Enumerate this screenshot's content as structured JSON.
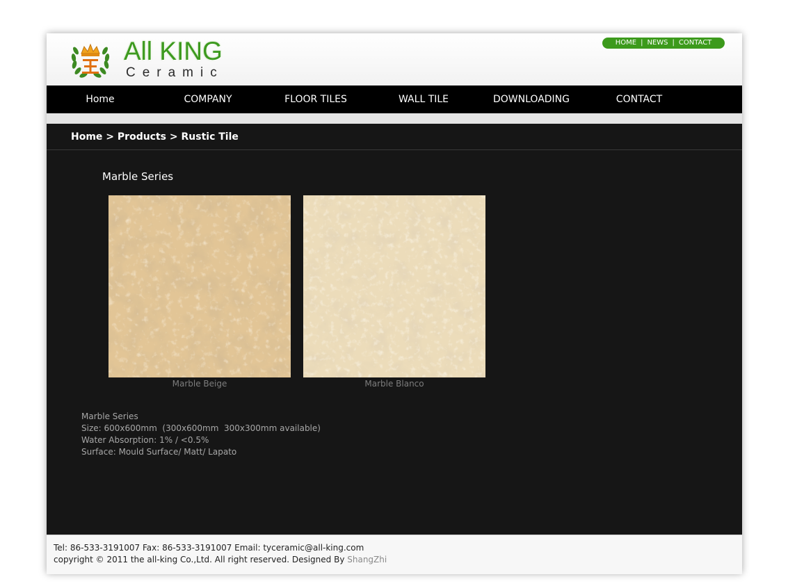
{
  "header": {
    "logo_text": "All KING",
    "logo_subtext": "Ceramic",
    "top_links": [
      "HOME",
      "NEWS",
      "CONTACT"
    ]
  },
  "nav": {
    "items": [
      "Home",
      "COMPANY",
      "FLOOR TILES",
      "WALL TILE",
      "DOWNLOADING",
      "CONTACT"
    ]
  },
  "breadcrumb": {
    "home": "Home",
    "products": "Products",
    "current": "Rustic Tile",
    "separator": ">"
  },
  "main": {
    "series_title": "Marble Series",
    "products": [
      {
        "name": "Marble Beige",
        "color": "#e2c596"
      },
      {
        "name": "Marble Blanco",
        "color": "#ecdcba"
      }
    ],
    "specs": [
      "Marble Series",
      "Size: 600x600mm  (300x600mm  300x300mm available)",
      "Water Absorption: 1% / <0.5%",
      "Surface: Mould Surface/ Matt/ Lapato"
    ]
  },
  "footer": {
    "contact_line": "Tel: 86-533-3191007 Fax: 86-533-3191007 Email: tyceramic@all-king.com",
    "copyright_text": "copyright © 2011 the all-king Co.,Ltd. All right reserved. Designed By ",
    "designer": "ShangZhi"
  },
  "colors": {
    "brand_green": "#3c9a1c",
    "nav_bg": "#000000",
    "content_bg": "#161616",
    "icon_crown": "crown-wreath-logo-icon"
  }
}
